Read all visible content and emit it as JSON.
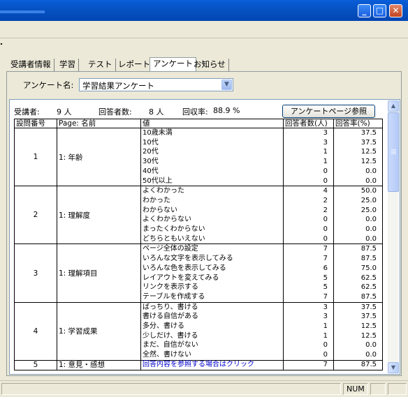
{
  "window": {
    "controls": {
      "minimize": "_",
      "maximize": "□",
      "close": "✕"
    }
  },
  "tabs": [
    {
      "label": "受講者情報",
      "active": false
    },
    {
      "label": "学習",
      "active": false
    },
    {
      "label": "テスト",
      "active": false
    },
    {
      "label": "レポート",
      "active": false
    },
    {
      "label": "アンケート",
      "active": true
    },
    {
      "label": "お知らせ",
      "active": false
    }
  ],
  "survey": {
    "label": "アンケート名:",
    "selected": "学習結果アンケート"
  },
  "summary": {
    "students_label": "受講者:",
    "students_value": "9 人",
    "respondents_label": "回答者数:",
    "respondents_value": "8 人",
    "rate_label": "回収率:",
    "rate_value": "88.9 %"
  },
  "page_button": "アンケートページ参照",
  "table": {
    "headers": {
      "qno": "設問番号",
      "page": "Page: 名前",
      "value": "値",
      "count": "回答者数(人)",
      "rate": "回答率(%)"
    },
    "rows": [
      {
        "qno": "1",
        "name": "1: 年齢",
        "values": "10歳未満\n10代\n20代\n30代\n40代\n50代以上",
        "counts": "3\n3\n1\n1\n0\n0",
        "rates": "37.5\n37.5\n12.5\n12.5\n0.0\n0.0"
      },
      {
        "qno": "2",
        "name": "1: 理解度",
        "values": "よくわかった\nわかった\nわからない\nよくわからない\nまったくわからない\nどちらともいえない",
        "counts": "4\n2\n2\n0\n0\n0",
        "rates": "50.0\n25.0\n25.0\n0.0\n0.0\n0.0"
      },
      {
        "qno": "3",
        "name": "1: 理解項目",
        "values": "ページ全体の設定\nいろんな文字を表示してみる\nいろんな色を表示してみる\nレイアウトを変えてみる\nリンクを表示する\nテーブルを作成する",
        "counts": "7\n7\n6\n5\n5\n7",
        "rates": "87.5\n87.5\n75.0\n62.5\n62.5\n87.5"
      },
      {
        "qno": "4",
        "name": "1: 学習成果",
        "values": "ばっちり、書ける\n書ける自信がある\n多分、書ける\n少しだけ、書ける\nまだ、自信がない\n全然、書けない",
        "counts": "3\n3\n1\n1\n0\n0",
        "rates": "37.5\n37.5\n12.5\n12.5\n0.0\n0.0"
      }
    ],
    "last_row": {
      "qno": "5",
      "name": "1: 意見・感想",
      "value": "回答内容を参照する場合はクリック",
      "count": "7",
      "rate": "87.5"
    }
  },
  "scrollbar": {
    "up": "▲",
    "down": "▼"
  },
  "combo_arrow": "▼",
  "status": {
    "num": "NUM"
  }
}
